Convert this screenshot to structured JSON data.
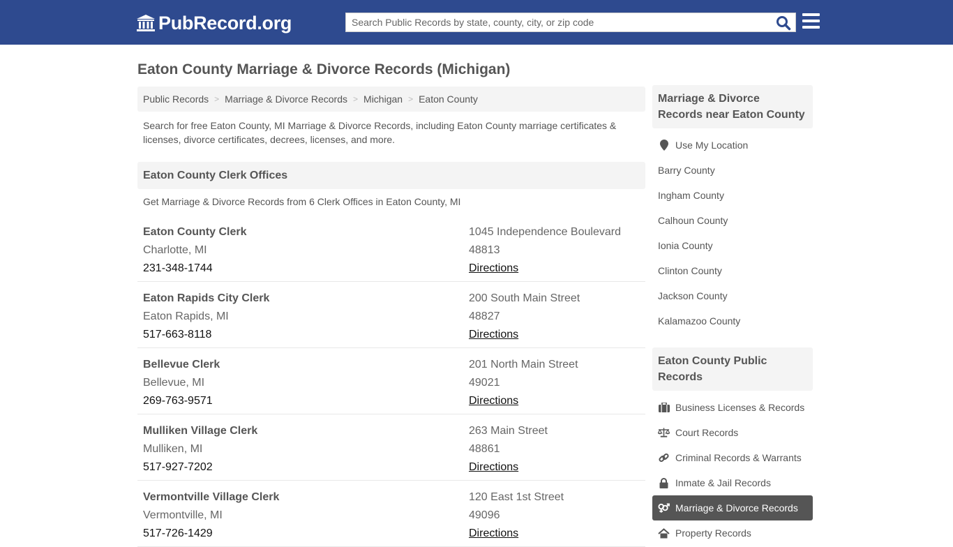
{
  "header": {
    "logo_text": "PubRecord.org",
    "search_placeholder": "Search Public Records by state, county, city, or zip code",
    "brand_color": "#2e4a8f"
  },
  "page_title": "Eaton County Marriage & Divorce Records (Michigan)",
  "breadcrumb": [
    "Public Records",
    "Marriage & Divorce Records",
    "Michigan",
    "Eaton County"
  ],
  "intro": "Search for free Eaton County, MI Marriage & Divorce Records, including Eaton County marriage certificates & licenses, divorce certificates, decrees, licenses, and more.",
  "offices_section": {
    "title": "Eaton County Clerk Offices",
    "subtitle": "Get Marriage & Divorce Records from 6 Clerk Offices in Eaton County, MI",
    "directions_label": "Directions",
    "items": [
      {
        "name": "Eaton County Clerk",
        "city": "Charlotte, MI",
        "phone": "231-348-1744",
        "address": "1045 Independence Boulevard",
        "zip": "48813"
      },
      {
        "name": "Eaton Rapids City Clerk",
        "city": "Eaton Rapids, MI",
        "phone": "517-663-8118",
        "address": "200 South Main Street",
        "zip": "48827"
      },
      {
        "name": "Bellevue Clerk",
        "city": "Bellevue, MI",
        "phone": "269-763-9571",
        "address": "201 North Main Street",
        "zip": "49021"
      },
      {
        "name": "Mulliken Village Clerk",
        "city": "Mulliken, MI",
        "phone": "517-927-7202",
        "address": "263 Main Street",
        "zip": "48861"
      },
      {
        "name": "Vermontville Village Clerk",
        "city": "Vermontville, MI",
        "phone": "517-726-1429",
        "address": "120 East 1st Street",
        "zip": "49096"
      }
    ]
  },
  "sidebar": {
    "nearby_title": "Marriage & Divorce Records near Eaton County",
    "use_location": "Use My Location",
    "nearby": [
      "Barry County",
      "Ingham County",
      "Calhoun County",
      "Ionia County",
      "Clinton County",
      "Jackson County",
      "Kalamazoo County"
    ],
    "public_title": "Eaton County Public Records",
    "public_items": [
      {
        "label": "Business Licenses & Records",
        "icon": "briefcase-icon"
      },
      {
        "label": "Court Records",
        "icon": "scale-icon"
      },
      {
        "label": "Criminal Records & Warrants",
        "icon": "link-icon"
      },
      {
        "label": "Inmate & Jail Records",
        "icon": "lock-icon"
      },
      {
        "label": "Marriage & Divorce Records",
        "icon": "genders-icon",
        "active": true
      },
      {
        "label": "Property Records",
        "icon": "home-icon"
      }
    ]
  }
}
